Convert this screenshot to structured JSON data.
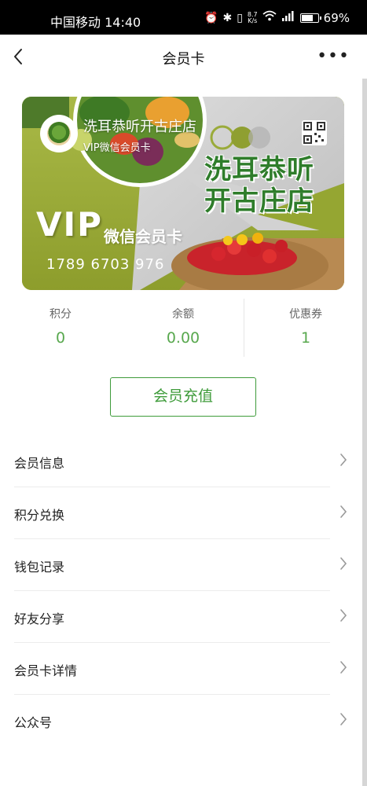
{
  "status_bar": {
    "carrier_time": "中国移动 14:40",
    "net_speed_value": "8.7",
    "net_speed_unit": "K/s",
    "battery": "69%",
    "icons": [
      "alarm-icon",
      "bluetooth-icon",
      "vibrate-icon",
      "wifi-icon",
      "signal-4g-icon",
      "battery-icon"
    ]
  },
  "nav": {
    "title": "会员卡",
    "back_icon": "chevron-left-icon",
    "more_icon": "more-dots-icon"
  },
  "card": {
    "store_name": "洗耳恭听开古庄店",
    "card_type": "VIP微信会员卡",
    "big_name_line1": "洗耳恭听",
    "big_name_line2": "开古庄店",
    "vip": "VIP",
    "vip_sub": "微信会员卡",
    "card_number": "1789 6703 976",
    "colors": {
      "olive": "#9aab3a",
      "dark_olive": "#7d8f25",
      "grey": "#c9c9c9",
      "title_green": "#2f7d2b"
    }
  },
  "stats": [
    {
      "label": "积分",
      "value": "0"
    },
    {
      "label": "余额",
      "value": "0.00"
    },
    {
      "label": "优惠券",
      "value": "1"
    }
  ],
  "recharge_button": "会员充值",
  "menu": [
    {
      "label": "会员信息"
    },
    {
      "label": "积分兑换"
    },
    {
      "label": "钱包记录"
    },
    {
      "label": "好友分享"
    },
    {
      "label": "会员卡详情"
    },
    {
      "label": "公众号"
    }
  ],
  "accent_color": "#3e9b3a"
}
